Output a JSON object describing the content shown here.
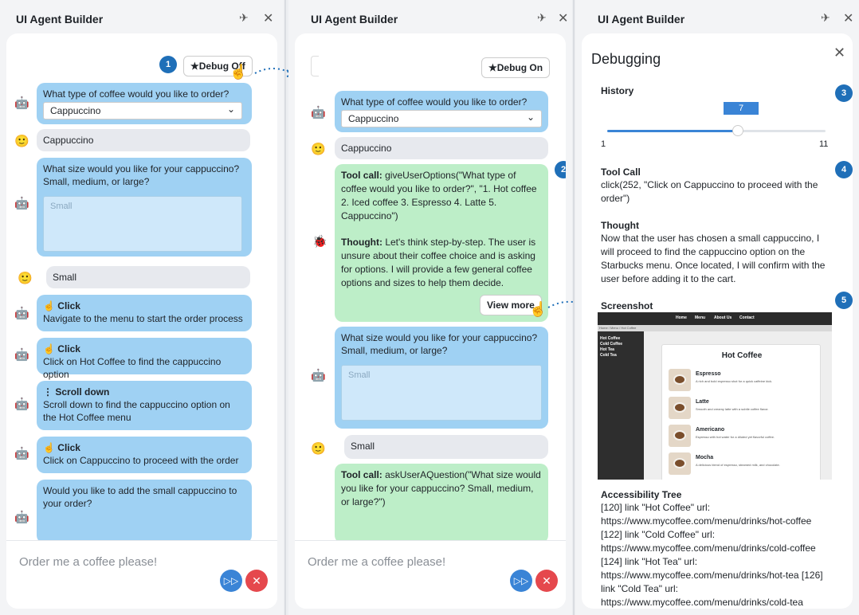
{
  "app_title": "UI Agent Builder",
  "panel1": {
    "debug_label": "★Debug Off",
    "messages": [
      {
        "role": "bot",
        "text": "What type of coffee would you like to order?",
        "select": "Cappuccino"
      },
      {
        "role": "user",
        "text": "Cappuccino"
      },
      {
        "role": "bot",
        "text": "What size would you like for your cappuccino? Small, medium, or large?",
        "textarea": "Small"
      },
      {
        "role": "user",
        "text": "Small"
      },
      {
        "role": "bot",
        "action": "Click",
        "text": "Navigate to the menu to start the order process"
      },
      {
        "role": "bot",
        "action": "Click",
        "text": "Click on Hot Coffee to find the cappuccino option"
      },
      {
        "role": "bot",
        "action": "Scroll down",
        "text": "Scroll down to find the cappuccino option on the Hot Coffee menu"
      },
      {
        "role": "bot",
        "action": "Click",
        "text": "Click on Cappuccino to proceed with the order"
      },
      {
        "role": "bot",
        "text": "Would you like to add the small cappuccino to your order?"
      }
    ],
    "input_placeholder": "Order me a coffee please!"
  },
  "panel2": {
    "debug_label": "★Debug On",
    "messages": [
      {
        "role": "bot",
        "text": "What type of coffee would you like to order?",
        "select": "Cappuccino"
      },
      {
        "role": "user",
        "text": "Cappuccino"
      },
      {
        "role": "debug",
        "tool_call_label": "Tool call:",
        "tool_call": " giveUserOptions(\"What type of coffee would you like to order?\", \"1. Hot coffee 2. Iced coffee 3. Espresso 4. Latte 5. Cappuccino\")",
        "thought_label": "Thought:",
        "thought": " Let's think step-by-step. The user is unsure about their coffee choice and is asking for options. I will provide a few general coffee options and sizes to help them decide.",
        "view_more": "View more"
      },
      {
        "role": "bot",
        "text": "What size would you like for your cappuccino? Small, medium, or large?",
        "textarea": "Small"
      },
      {
        "role": "user",
        "text": "Small"
      },
      {
        "role": "debug",
        "tool_call_label": "Tool call:",
        "tool_call": " askUserAQuestion(\"What size would you like for your cappuccino? Small, medium, or large?\")"
      }
    ],
    "input_placeholder": "Order me a coffee please!"
  },
  "panel3": {
    "heading": "Debugging",
    "history": {
      "label": "History",
      "value": "7",
      "min": "1",
      "max": "11",
      "fraction": 0.6
    },
    "tool_call": {
      "label": "Tool Call",
      "text": "click(252, \"Click on Cappuccino to proceed with the order\")"
    },
    "thought": {
      "label": "Thought",
      "text": "Now that the user has chosen a small cappuccino, I will proceed to find the cappuccino option on the Starbucks menu. Once located, I will confirm with the user before adding it to the cart."
    },
    "screenshot": {
      "label": "Screenshot",
      "nav": [
        "Home",
        "Menu",
        "About Us",
        "Contact"
      ],
      "crumb": "Home / Menu / Hot Coffee",
      "side": [
        "Hot Coffee",
        "Cold Coffee",
        "Hot Tea",
        "Cold Tea"
      ],
      "heading": "Hot Coffee",
      "items": [
        {
          "name": "Espresso",
          "desc": "A rich and bold espresso shot for a quick caffeine kick."
        },
        {
          "name": "Latte",
          "desc": "Smooth and creamy latte with a subtle coffee flavor."
        },
        {
          "name": "Americano",
          "desc": "Espresso with hot water for a diluted yet flavorful coffee."
        },
        {
          "name": "Mocha",
          "desc": "A delicious blend of espresso, steamed milk, and chocolate."
        }
      ]
    },
    "a11y": {
      "label": "Accessibility Tree",
      "text": "[120] link \"Hot Coffee\" url: https://www.mycoffee.com/menu/drinks/hot-coffee [122] link \"Cold Coffee\" url: https://www.mycoffee.com/menu/drinks/cold-coffee [124] link \"Hot Tea\" url: https://www.mycoffee.com/menu/drinks/hot-tea [126] link \"Cold Tea\" url: https://www.mycoffee.com/menu/drinks/cold-tea"
    }
  },
  "badges": [
    "1",
    "2",
    "3",
    "4",
    "5"
  ],
  "colors": {
    "bot": "#9fd1f3",
    "user": "#e7e9ee",
    "debug": "#bdeec8",
    "accent": "#1f6fb8"
  }
}
